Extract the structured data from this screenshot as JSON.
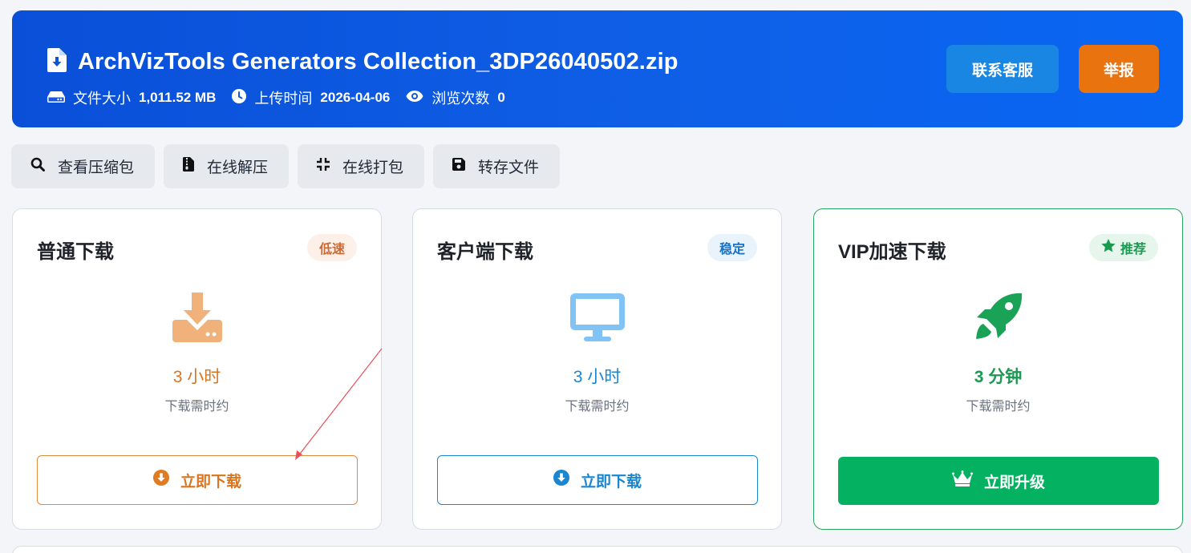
{
  "header": {
    "file_name": "ArchVizTools Generators Collection_3DP26040502.zip",
    "file_icon": "file-download-icon",
    "meta": [
      {
        "icon": "hard-drive-icon",
        "label": "文件大小",
        "value": "1,011.52 MB"
      },
      {
        "icon": "clock-icon",
        "label": "上传时间",
        "value": "2026-04-06"
      },
      {
        "icon": "eye-icon",
        "label": "浏览次数",
        "value": "0"
      }
    ],
    "contact_label": "联系客服",
    "report_label": "举报"
  },
  "toolbar": {
    "items": [
      {
        "icon": "search-icon",
        "label": "查看压缩包"
      },
      {
        "icon": "file-zipper-icon",
        "label": "在线解压"
      },
      {
        "icon": "compress-icon",
        "label": "在线打包"
      },
      {
        "icon": "floppy-disk-icon",
        "label": "转存文件"
      }
    ]
  },
  "cards": [
    {
      "title": "普通下载",
      "badge": "低速",
      "icon": "download-tray-icon",
      "time": "3 小时",
      "subtitle": "下载需时约",
      "action": "立即下载",
      "action_icon": "circle-down-icon"
    },
    {
      "title": "客户端下载",
      "badge": "稳定",
      "icon": "desktop-icon",
      "time": "3 小时",
      "subtitle": "下载需时约",
      "action": "立即下载",
      "action_icon": "circle-down-icon"
    },
    {
      "title": "VIP加速下载",
      "badge": "推荐",
      "badge_icon": "star-icon",
      "icon": "rocket-icon",
      "time": "3 分钟",
      "subtitle": "下载需时约",
      "action": "立即升级",
      "action_icon": "crown-icon"
    }
  ],
  "colors": {
    "header_blue": "#0a4fd8",
    "contact_blue": "#1a86e3",
    "report_orange": "#e8730f",
    "slow_orange": "#d9751f",
    "stable_blue": "#1a86d0",
    "vip_green": "#03b160",
    "annotation_arrow": "#e8505b"
  }
}
